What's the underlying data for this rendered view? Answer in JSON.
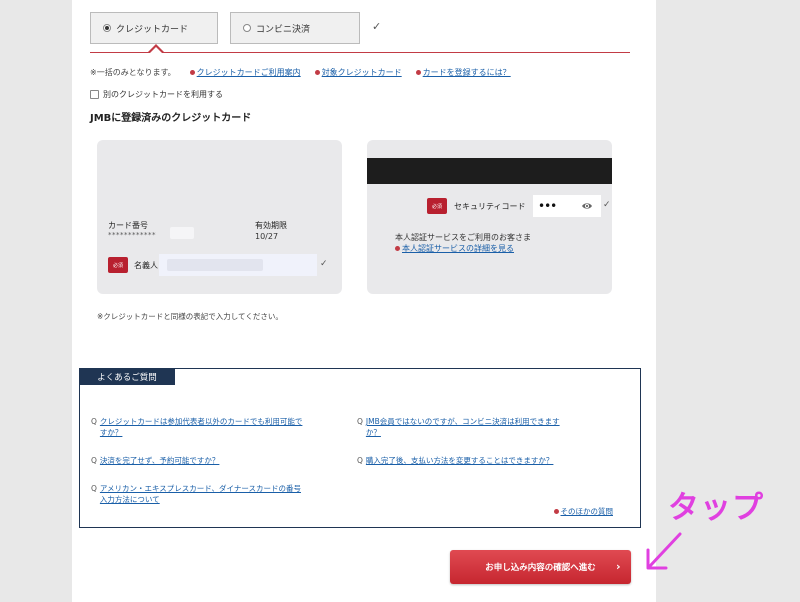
{
  "payment_tabs": {
    "credit_card": "クレジットカード",
    "convenience_store": "コンビニ決済",
    "check": "✓"
  },
  "notes": {
    "lump_sum": "※一括のみとなります。",
    "link_guide": "クレジットカードご利用案内",
    "link_eligible": "対象クレジットカード",
    "link_register": "カードを登録するには？"
  },
  "use_other_card": "別のクレジットカードを利用する",
  "section_title": "JMBに登録済みのクレジットカード",
  "card_front": {
    "number_label": "カード番号",
    "number_value": "************",
    "expiry_label": "有効期限",
    "expiry_value": "10/27",
    "required_badge": "必須",
    "name_label": "名義人",
    "check": "✓"
  },
  "card_back": {
    "required_badge": "必須",
    "security_label": "セキュリティコード",
    "security_value": "•••",
    "check": "✓",
    "auth_text": "本人認証サービスをご利用のお客さま",
    "auth_link": "本人認証サービスの詳細を見る"
  },
  "card_note": "※クレジットカードと同様の表記で入力してください。",
  "faq": {
    "title": "よくあるご質問",
    "q_prefix": "Q",
    "q1_line1": "クレジットカードは参加代表者以外のカードでも利用可能で",
    "q1_line2": "すか？",
    "q2": "決済を完了せず、予約可能ですか？",
    "q3_line1": "アメリカン・エキスプレスカード、ダイナースカードの番号",
    "q3_line2": "入力方法について",
    "q4_line1": "JMB会員ではないのですが、コンビニ決済は利用できます",
    "q4_line2": "か？",
    "q5": "購入完了後、支払い方法を変更することはできますか？",
    "more": "そのほかの質問"
  },
  "submit": {
    "label": "お申し込み内容の確認へ進む",
    "chevron": "›"
  },
  "annotation": {
    "tap": "タップ"
  },
  "colors": {
    "accent_red": "#c23b45",
    "navy": "#1f3553",
    "link_blue": "#1a5fa8",
    "annotation_magenta": "#e040e0"
  }
}
